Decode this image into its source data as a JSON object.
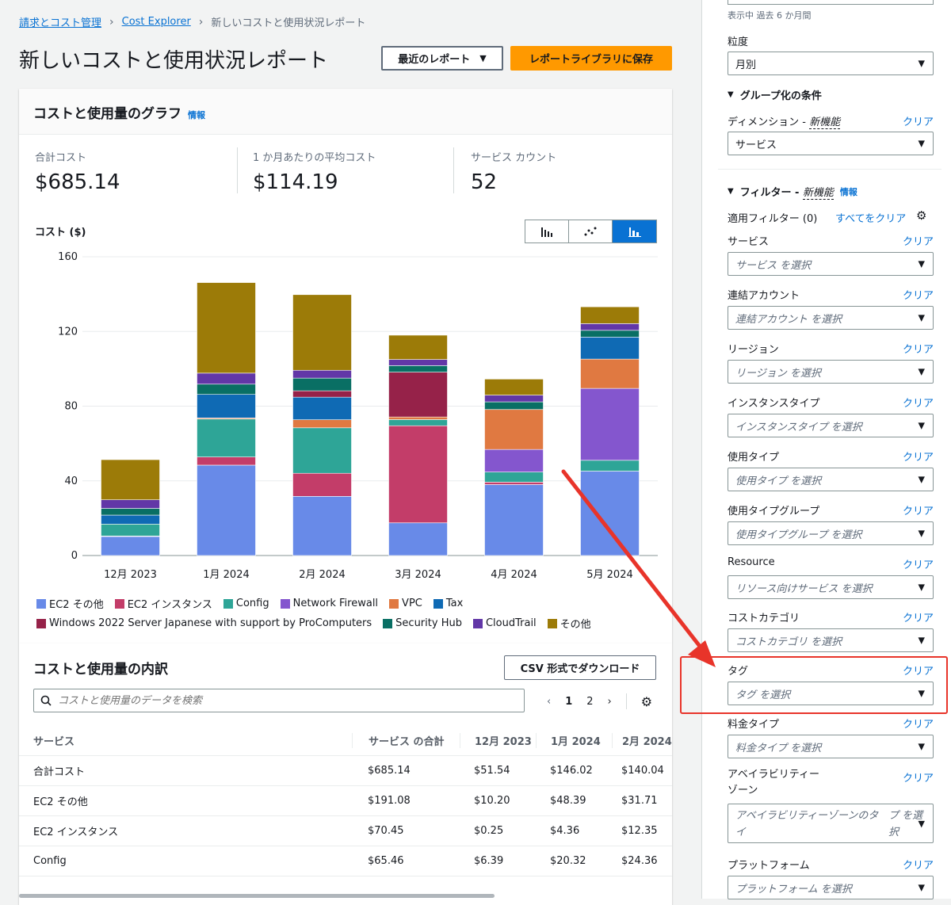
{
  "breadcrumb": {
    "root": "請求とコスト管理",
    "middle": "Cost Explorer",
    "current": "新しいコストと使用状況レポート"
  },
  "page": {
    "title": "新しいコストと使用状況レポート",
    "recent_reports": "最近のレポート",
    "save_button": "レポートライブラリに保存"
  },
  "graph_card": {
    "title": "コストと使用量のグラフ",
    "info": "情報",
    "kpis": [
      {
        "label": "合計コスト",
        "value": "$685.14"
      },
      {
        "label": "1 か月あたりの平均コスト",
        "value": "$114.19"
      },
      {
        "label": "サービス カウント",
        "value": "52"
      }
    ],
    "y_label": "コスト ($)"
  },
  "chart_data": {
    "type": "bar",
    "stacked": true,
    "categories": [
      "12月 2023",
      "1月 2024",
      "2月 2024",
      "3月 2024",
      "4月 2024",
      "5月 2024"
    ],
    "ylim": [
      0,
      160
    ],
    "yticks": [
      0,
      40,
      80,
      120,
      160
    ],
    "ylabel": "コスト ($)",
    "grid": true,
    "legend_position": "bottom",
    "series": [
      {
        "name": "EC2 その他",
        "color": "#688ae8",
        "values": [
          10.2,
          48.4,
          31.7,
          17.5,
          38,
          45.2
        ]
      },
      {
        "name": "EC2 インスタンス",
        "color": "#c33d69",
        "values": [
          0.25,
          4.36,
          12.35,
          52,
          1.3,
          0
        ]
      },
      {
        "name": "Config",
        "color": "#2ea597",
        "values": [
          6.39,
          20.32,
          24.36,
          3.3,
          5.4,
          5.8
        ]
      },
      {
        "name": "Network Firewall",
        "color": "#8456ce",
        "values": [
          0,
          0,
          0,
          0,
          12.1,
          38.5
        ]
      },
      {
        "name": "VPC",
        "color": "#e07941",
        "values": [
          0,
          0.6,
          4.3,
          1.4,
          21.4,
          15.7
        ]
      },
      {
        "name": "Tax",
        "color": "#0f6ab4",
        "values": [
          4.8,
          12.6,
          12.1,
          0,
          0,
          11.8
        ]
      },
      {
        "name": "Windows 2022 Server Japanese with support by ProComputers",
        "color": "#962249",
        "values": [
          0,
          0,
          3.4,
          24,
          0,
          0
        ]
      },
      {
        "name": "Security Hub",
        "color": "#096f64",
        "values": [
          3.6,
          5.5,
          6.8,
          3.5,
          4.1,
          3.6
        ]
      },
      {
        "name": "CloudTrail",
        "color": "#6237a7",
        "values": [
          4.6,
          5.9,
          4.2,
          3.3,
          3.6,
          3.6
        ]
      },
      {
        "name": "その他",
        "color": "#9c7b08",
        "values": [
          21.5,
          48.5,
          40.5,
          13,
          8.6,
          9
        ]
      }
    ]
  },
  "breakdown": {
    "title": "コストと使用量の内訳",
    "download": "CSV 形式でダウンロード",
    "search_placeholder": "コストと使用量のデータを検索",
    "pages": [
      "1",
      "2"
    ],
    "columns": [
      "サービス",
      "サービス の合計",
      "12月 2023",
      "1月 2024",
      "2月 2024"
    ],
    "rows": [
      [
        "合計コスト",
        "$685.14",
        "$51.54",
        "$146.02",
        "$140.04"
      ],
      [
        "EC2 その他",
        "$191.08",
        "$10.20",
        "$48.39",
        "$31.71"
      ],
      [
        "EC2 インスタンス",
        "$70.45",
        "$0.25",
        "$4.36",
        "$12.35"
      ],
      [
        "Config",
        "$65.46",
        "$6.39",
        "$20.32",
        "$24.36"
      ]
    ]
  },
  "sidebar": {
    "top_hint": "表示中 過去 6 か月間",
    "granularity_label": "粒度",
    "granularity_value": "月別",
    "group_section": "グループ化の条件",
    "dimension_label": "ディメンション",
    "new_feature": "新機能",
    "dimension_value": "サービス",
    "filter_section": "フィルター",
    "info": "情報",
    "applied_filters": "適用フィルター (0)",
    "clear_all": "すべてをクリア",
    "clear": "クリア",
    "filters": [
      {
        "label": "サービス",
        "placeholder": "サービス を選択"
      },
      {
        "label": "連結アカウント",
        "placeholder": "連結アカウント を選択"
      },
      {
        "label": "リージョン",
        "placeholder": "リージョン を選択"
      },
      {
        "label": "インスタンスタイプ",
        "placeholder": "インスタンスタイプ を選択"
      },
      {
        "label": "使用タイプ",
        "placeholder": "使用タイプ を選択"
      },
      {
        "label": "使用タイプグループ",
        "placeholder": "使用タイプグループ を選択"
      },
      {
        "label": "Resource",
        "placeholder": "リソース向けサービス を選択"
      },
      {
        "label": "コストカテゴリ",
        "placeholder": "コストカテゴリ を選択"
      },
      {
        "label": "タグ",
        "placeholder": "タグ を選択"
      },
      {
        "label": "料金タイプ",
        "placeholder": "料金タイプ を選択"
      },
      {
        "label": "アベイラビリティー",
        "label2": "ゾーン",
        "placeholder": "アベイラビリティーゾーンのタイ",
        "placeholder2": "プ を選択"
      },
      {
        "label": "プラットフォーム",
        "placeholder": "プラットフォーム を選択"
      }
    ]
  }
}
